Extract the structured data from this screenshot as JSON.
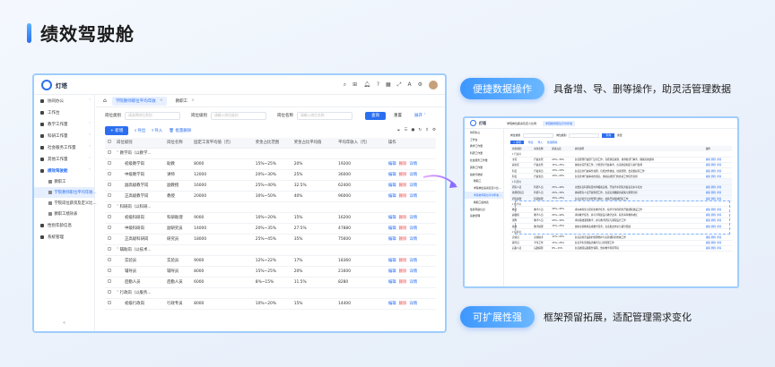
{
  "title": "绩效驾驶舱",
  "features": [
    {
      "label": "便捷数据操作",
      "desc": "具备增、导、删等操作，助灵活管理数据"
    },
    {
      "label": "可扩展性强",
      "desc": "框架预留拓展，适配管理需求变化"
    }
  ],
  "colors": {
    "accent": "#2b6ff0",
    "border": "#9fcdfb",
    "danger": "#e84a4a"
  },
  "app": {
    "brand": "灯塔",
    "sidebar": [
      {
        "label": "协同办公",
        "icon": "grid-icon",
        "expandable": true
      },
      {
        "label": "工作台",
        "icon": "desk-icon",
        "expandable": false
      },
      {
        "label": "教学工作量",
        "icon": "book-icon",
        "expandable": true
      },
      {
        "label": "科研工作量",
        "icon": "flask-icon",
        "expandable": true
      },
      {
        "label": "社会服务工作量",
        "icon": "service-icon",
        "expandable": true
      },
      {
        "label": "其他工作量",
        "icon": "list-icon",
        "expandable": true
      },
      {
        "label": "绩效驾驶舱",
        "icon": "dashboard-icon",
        "expandable": true,
        "selected": true
      }
    ],
    "sidebar_sub": [
      {
        "label": "教职工",
        "selected": false
      },
      {
        "label": "学院教师职位平均年收...",
        "selected": true
      },
      {
        "label": "学院岗位薪资及定义比...",
        "selected": false
      },
      {
        "label": "教职工绩效表",
        "selected": false
      }
    ],
    "sidebar_tail": [
      {
        "label": "性别年龄信息",
        "icon": "user-icon"
      },
      {
        "label": "系统管理",
        "icon": "settings-icon"
      }
    ],
    "collapse": "«",
    "tabs": [
      {
        "label": "学院教师职位平均年收",
        "active": true
      },
      {
        "label": "教职工",
        "active": false
      }
    ],
    "filter": {
      "f1_label": "岗位类别",
      "f1_placeholder": "请选择岗位类别",
      "f2_label": "岗位级别",
      "f2_placeholder": "请输入岗位级别",
      "f3_label": "岗位名称",
      "f3_placeholder": "请输入岗位名称",
      "search": "查询",
      "reset": "重置",
      "expand": "展开"
    },
    "actions": {
      "add": "+ 新增",
      "export": "导出",
      "import": "导入",
      "batch_delete": "批量删除"
    },
    "columns": [
      "岗位级别",
      "岗位名称",
      "固定工资平均值（元）",
      "奖金占比范围",
      "奖金占比平均值",
      "平均年收入（元）",
      "操作"
    ],
    "rows": [
      {
        "type": "group",
        "level": "教学岗（以教学...",
        "expanded": true
      },
      {
        "type": "row",
        "level": "初级教学岗",
        "name": "助教",
        "salary": "8000",
        "range": "15%~25%",
        "avg": "20%",
        "income": "19200"
      },
      {
        "type": "row",
        "level": "中级教学岗",
        "name": "讲师",
        "salary": "12000",
        "range": "20%~30%",
        "avg": "25%",
        "income": "36000"
      },
      {
        "type": "row",
        "level": "副高级教学岗",
        "name": "副教授",
        "salary": "16000",
        "range": "25%~40%",
        "avg": "32.5%",
        "income": "62400"
      },
      {
        "type": "row",
        "level": "正高级教学岗",
        "name": "教授",
        "salary": "20000",
        "range": "30%~50%",
        "avg": "40%",
        "income": "96000"
      },
      {
        "type": "group",
        "level": "科研岗（以科研...",
        "expanded": true
      },
      {
        "type": "row",
        "level": "初级科研岗",
        "name": "科研助理",
        "salary": "9000",
        "range": "10%~20%",
        "avg": "15%",
        "income": "16200"
      },
      {
        "type": "row",
        "level": "中级科研岗",
        "name": "副研究员",
        "salary": "14000",
        "range": "20%~35%",
        "avg": "27.5%",
        "income": "47880"
      },
      {
        "type": "row",
        "level": "正高级科研岗",
        "name": "研究员",
        "salary": "18000",
        "range": "25%~45%",
        "avg": "35%",
        "income": "75600"
      },
      {
        "type": "group",
        "level": "辅助岗（以技术...",
        "expanded": true
      },
      {
        "type": "row",
        "level": "实验员",
        "name": "实验员",
        "salary": "9000",
        "range": "12%~22%",
        "avg": "17%",
        "income": "18360"
      },
      {
        "type": "row",
        "level": "辅导员",
        "name": "辅导员",
        "salary": "8000",
        "range": "15%~25%",
        "avg": "20%",
        "income": "21600"
      },
      {
        "type": "row",
        "level": "后勤人员",
        "name": "后勤人员",
        "salary": "6000",
        "range": "8%~15%",
        "avg": "11.5%",
        "income": "8280"
      },
      {
        "type": "group",
        "level": "行政岗（以服务...",
        "expanded": true
      },
      {
        "type": "row",
        "level": "初级行政岗",
        "name": "行政专员",
        "salary": "8000",
        "range": "10%~20%",
        "avg": "15%",
        "income": "14400"
      }
    ],
    "row_actions": {
      "edit": "编辑",
      "delete": "删除",
      "detail": "详情"
    }
  },
  "app2": {
    "tabs": [
      "学院岗位薪资及定义比例",
      "学院教师职位平均年收"
    ],
    "sidebar": [
      "协同办公",
      "工作台",
      "教学工作量",
      "科研工作量",
      "社会服务工作量",
      "其他工作量",
      "绩效驾驶舱",
      "教职工",
      "学院岗位薪资及定义比...",
      "学院教师职位平均年收...",
      "教职工绩效表",
      "性别年龄信息",
      "系统管理"
    ],
    "columns": [
      "岗位类别",
      "岗位名称",
      "薪资占比",
      "岗位说明",
      "操作"
    ],
    "rows": [
      {
        "a": "▾ 行政岗",
        "b": "",
        "c": "",
        "d": "",
        "grp": true
      },
      {
        "a": "主任",
        "b": "行政主管",
        "c": "20%~30%",
        "d": "负责管理行政部门日常工作，包括调度资源、协调各部门事务，确保高效运转"
      },
      {
        "a": "副主任",
        "b": "行政主管",
        "c": "15%~25%",
        "d": "协助主任开展工作，分管部分行政事务，负责制度制定与执行监督"
      },
      {
        "a": "科员",
        "b": "行政专员",
        "c": "10%~20%",
        "d": "负责日常行政事务处理，包括文件收发、档案管理、会议组织等工作"
      },
      {
        "a": "科员",
        "b": "行政专员",
        "c": "10%~20%",
        "d": "负责具体行政事项的落实，协助完成部门的各项工作任务安排"
      },
      {
        "a": "▾ 科研岗",
        "b": "",
        "c": "",
        "d": "",
        "grp": true,
        "hl": true
      },
      {
        "a": "研究人员",
        "b": "科研人员",
        "c": "25%~40%",
        "d": "主要负责科研项目的申报和实施，开展学术研究并发表高水平论文",
        "hl": true
      },
      {
        "a": "助理研究员",
        "b": "科研人员",
        "c": "20%~30%",
        "d": "协助研究人员开展科研工作，负责实验数据的采集与整理分析",
        "hl": true
      },
      {
        "a": "研究助理",
        "b": "科研助理",
        "c": "15%~25%",
        "d": "负责实验室日常管理与维护，协助开展基础研究工作",
        "hl": true
      },
      {
        "a": "▾ 教学岗",
        "b": "",
        "c": "",
        "d": "",
        "grp": true
      },
      {
        "a": "教授",
        "b": "教学人员",
        "c": "30%~45%",
        "d": "承担本科生与研究生教学任务，指导学生科研并开展课程建设工作"
      },
      {
        "a": "副教授",
        "b": "教学人员",
        "c": "25%~40%",
        "d": "承担教学任务，参与学科建设与教学改革，指导青年教师成长"
      },
      {
        "a": "讲师",
        "b": "教学人员",
        "c": "20%~30%",
        "d": "承担基础课程教学，参与教学研究与课程设计工作"
      },
      {
        "a": "助教",
        "b": "教学助理",
        "c": "15%~25%",
        "d": "协助主讲教师完成教学任务，负责批改作业与辅导答疑"
      },
      {
        "a": "▾ 辅助岗",
        "b": "",
        "c": "",
        "d": "",
        "grp": true
      },
      {
        "a": "实验员",
        "b": "实验技术",
        "c": "12%~22%",
        "d": "负责实验室设备的管理维护与实验课程的准备工作"
      },
      {
        "a": "辅导员",
        "b": "学生工作",
        "c": "15%~25%",
        "d": "负责学生思想政治教育与日常管理工作"
      },
      {
        "a": "后勤人员",
        "b": "后勤保障",
        "c": "8%~15%",
        "d": "负责校园后勤服务保障，维护教学科研环境"
      }
    ],
    "row_actions": "编辑 删除 详情"
  }
}
